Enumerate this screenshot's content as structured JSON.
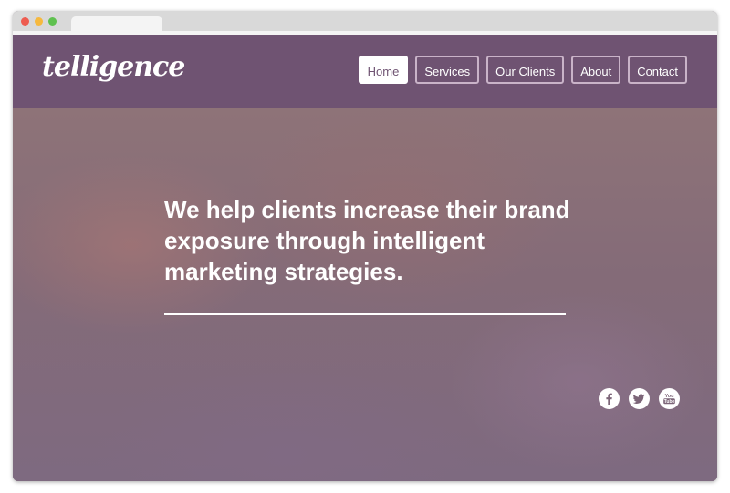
{
  "brand": {
    "logo_text": "telligence"
  },
  "nav": {
    "items": [
      {
        "label": "Home",
        "active": true
      },
      {
        "label": "Services",
        "active": false
      },
      {
        "label": "Our Clients",
        "active": false
      },
      {
        "label": "About",
        "active": false
      },
      {
        "label": "Contact",
        "active": false
      }
    ]
  },
  "hero": {
    "headline": "We help clients increase their brand exposure through intelligent marketing strategies."
  },
  "social": {
    "icons": [
      "facebook-icon",
      "twitter-icon",
      "youtube-icon"
    ],
    "youtube_label": "You Tube"
  },
  "colors": {
    "header_bg": "#6f5372",
    "accent": "#c9b3c8",
    "text": "#ffffff"
  }
}
